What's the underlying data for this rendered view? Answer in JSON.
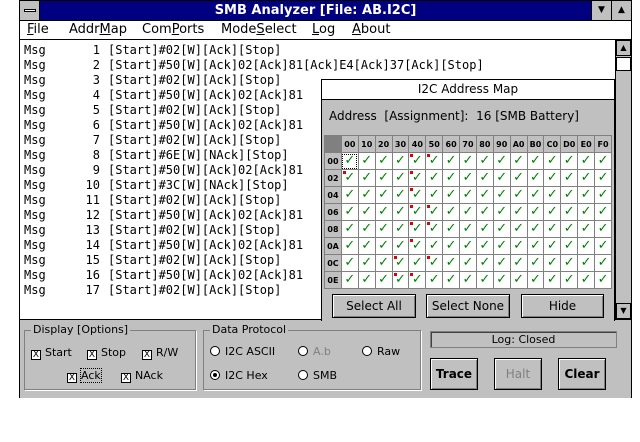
{
  "window": {
    "title": "SMB Analyzer [File: AB.I2C]"
  },
  "menu": [
    {
      "pre": "",
      "ul": "F",
      "post": "ile"
    },
    {
      "pre": "Addr",
      "ul": "M",
      "post": "ap"
    },
    {
      "pre": "Com",
      "ul": "P",
      "post": "orts"
    },
    {
      "pre": "Mode",
      "ul": "S",
      "post": "elect"
    },
    {
      "pre": "",
      "ul": "L",
      "post": "og"
    },
    {
      "pre": "",
      "ul": "A",
      "post": "bout"
    }
  ],
  "log": [
    {
      "tag": "Msg",
      "num": "1",
      "text": "[Start]#02[W][Ack][Stop]"
    },
    {
      "tag": "Msg",
      "num": "2",
      "text": "[Start]#50[W][Ack]02[Ack]81[Ack]E4[Ack]37[Ack][Stop]"
    },
    {
      "tag": "Msg",
      "num": "3",
      "text": "[Start]#02[W][Ack][Stop]"
    },
    {
      "tag": "Msg",
      "num": "4",
      "text": "[Start]#50[W][Ack]02[Ack]81"
    },
    {
      "tag": "Msg",
      "num": "5",
      "text": "[Start]#02[W][Ack][Stop]"
    },
    {
      "tag": "Msg",
      "num": "6",
      "text": "[Start]#50[W][Ack]02[Ack]81"
    },
    {
      "tag": "Msg",
      "num": "7",
      "text": "[Start]#02[W][Ack][Stop]"
    },
    {
      "tag": "Msg",
      "num": "8",
      "text": "[Start]#6E[W][NAck][Stop]"
    },
    {
      "tag": "Msg",
      "num": "9",
      "text": "[Start]#50[W][Ack]02[Ack]81"
    },
    {
      "tag": "Msg",
      "num": "10",
      "text": "[Start]#3C[W][NAck][Stop]"
    },
    {
      "tag": "Msg",
      "num": "11",
      "text": "[Start]#02[W][Ack][Stop]"
    },
    {
      "tag": "Msg",
      "num": "12",
      "text": "[Start]#50[W][Ack]02[Ack]81"
    },
    {
      "tag": "Msg",
      "num": "13",
      "text": "[Start]#02[W][Ack][Stop]"
    },
    {
      "tag": "Msg",
      "num": "14",
      "text": "[Start]#50[W][Ack]02[Ack]81"
    },
    {
      "tag": "Msg",
      "num": "15",
      "text": "[Start]#02[W][Ack][Stop]"
    },
    {
      "tag": "Msg",
      "num": "16",
      "text": "[Start]#50[W][Ack]02[Ack]81"
    },
    {
      "tag": "Msg",
      "num": "17",
      "text": "[Start]#02[W][Ack][Stop]"
    }
  ],
  "address_map": {
    "title": "I2C Address Map",
    "info": "Address  [Assignment]:  16 [SMB Battery]",
    "col_headers": [
      "00",
      "10",
      "20",
      "30",
      "40",
      "50",
      "60",
      "70",
      "80",
      "90",
      "A0",
      "B0",
      "C0",
      "D0",
      "E0",
      "F0"
    ],
    "row_headers": [
      "00",
      "02",
      "04",
      "06",
      "08",
      "0A",
      "0C",
      "0E"
    ],
    "check_glyph": "✓",
    "red_marks": [
      [
        0,
        4
      ],
      [
        0,
        5
      ],
      [
        1,
        0
      ],
      [
        1,
        4
      ],
      [
        2,
        4
      ],
      [
        3,
        4
      ],
      [
        3,
        5
      ],
      [
        4,
        4
      ],
      [
        4,
        5
      ],
      [
        5,
        4
      ],
      [
        6,
        3
      ],
      [
        6,
        5
      ],
      [
        7,
        3
      ],
      [
        7,
        4
      ]
    ],
    "buttons": {
      "select_all": "Select All",
      "select_none": "Select None",
      "hide": "Hide"
    }
  },
  "display_options": {
    "label": "Display [Options]",
    "items": [
      {
        "label": "Start",
        "checked": true
      },
      {
        "label": "Stop",
        "checked": true
      },
      {
        "label": "R/W",
        "checked": true
      },
      {
        "label": "Ack",
        "checked": true
      },
      {
        "label": "NAck",
        "checked": true
      }
    ]
  },
  "data_protocol": {
    "label": "Data Protocol",
    "items": [
      {
        "label": "I2C ASCII",
        "selected": false,
        "disabled": false
      },
      {
        "label": "A.b",
        "selected": false,
        "disabled": true
      },
      {
        "label": "Raw",
        "selected": false,
        "disabled": false
      },
      {
        "label": "I2C Hex",
        "selected": true,
        "disabled": false
      },
      {
        "label": "SMB",
        "selected": false,
        "disabled": false
      }
    ]
  },
  "status": "Log: Closed",
  "actions": {
    "trace": "Trace",
    "halt": "Halt",
    "clear": "Clear"
  },
  "colors": {
    "title_bar": "#000080",
    "check": "#008000",
    "mark": "#e00000"
  }
}
